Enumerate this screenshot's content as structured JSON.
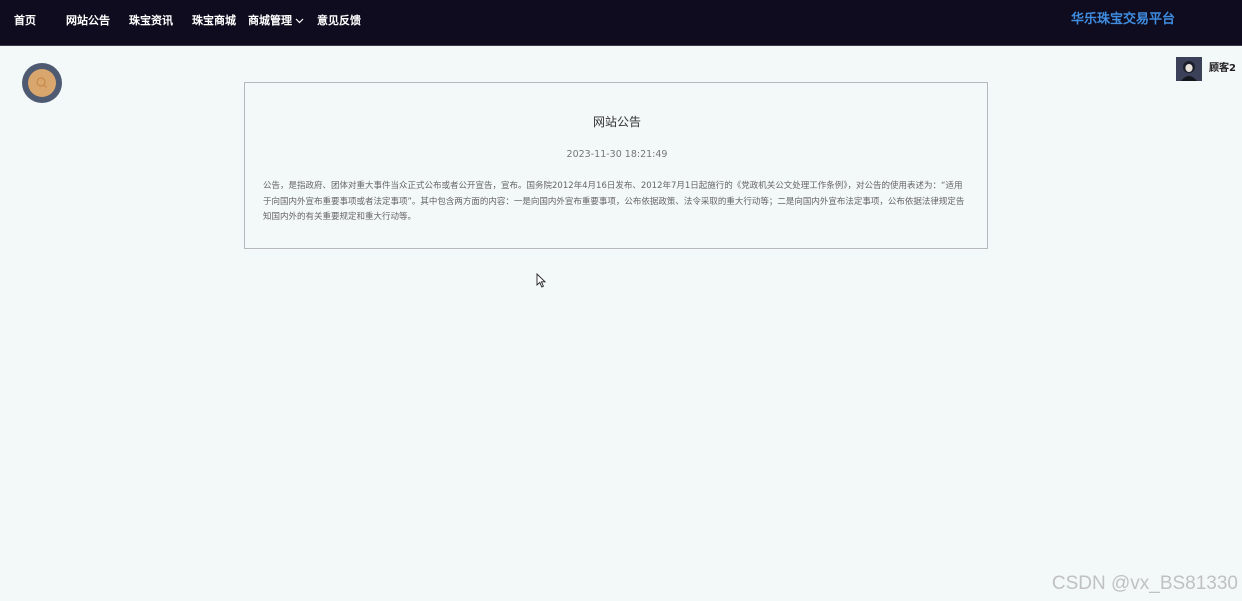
{
  "nav": {
    "items": [
      {
        "label": "首页"
      },
      {
        "label": "网站公告"
      },
      {
        "label": "珠宝资讯"
      },
      {
        "label": "珠宝商城"
      },
      {
        "label": "商城管理",
        "icon": "chevron-down-icon"
      },
      {
        "label": "意见反馈"
      }
    ],
    "brand": "华乐珠宝交易平台"
  },
  "user": {
    "name": "顾客2",
    "avatar_icon": "avatar"
  },
  "search_button": {
    "icon": "search-icon"
  },
  "notice": {
    "title": "网站公告",
    "datetime": "2023-11-30 18:21:49",
    "body": "公告，是指政府、团体对重大事件当众正式公布或者公开宣告，宣布。国务院2012年4月16日发布、2012年7月1日起施行的《党政机关公文处理工作条例》，对公告的使用表述为：“适用于向国内外宣布重要事项或者法定事项”。其中包含两方面的内容：一是向国内外宣布重要事项，公布依据政策、法令采取的重大行动等；二是向国内外宣布法定事项，公布依据法律规定告知国内外的有关重要规定和重大行动等。"
  },
  "watermark": "CSDN @vx_BS81330",
  "colors": {
    "topbar": "#0e0c1e",
    "brand": "#3f8ce0",
    "page_bg": "#f3f8f9",
    "search_outer": "#4d5a72",
    "search_inner": "#d9a66d"
  }
}
